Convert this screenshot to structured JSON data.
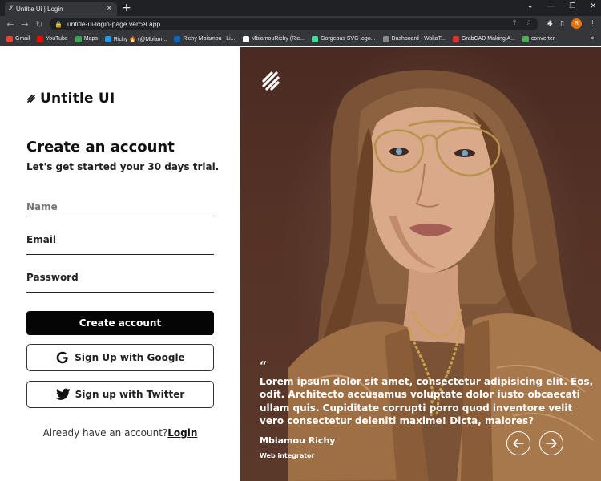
{
  "browser": {
    "tab_title": "Untitle Ui | Login",
    "url": "untitle-ui-login-page.vercel.app",
    "profile_initial": "R",
    "bookmarks": [
      {
        "label": "Gmail",
        "color": "#ea4335"
      },
      {
        "label": "YouTube",
        "color": "#ff0000"
      },
      {
        "label": "Maps",
        "color": "#34a853"
      },
      {
        "label": "Richy 🔥 (@Mbiam...",
        "color": "#1d9bf0"
      },
      {
        "label": "Richy Mbiamou | Li...",
        "color": "#0a66c2"
      },
      {
        "label": "MbiamouRichy (Ric...",
        "color": "#ffffff"
      },
      {
        "label": "Gorgeous SVG logo...",
        "color": "#3ddc97"
      },
      {
        "label": "Dashboard - WakaT...",
        "color": "#888888"
      },
      {
        "label": "GrabCAD Making A...",
        "color": "#e0312b"
      },
      {
        "label": "converter",
        "color": "#4caf50"
      }
    ]
  },
  "brand": {
    "name": "Untitle UI"
  },
  "form": {
    "heading": "Create an account",
    "subheading": "Let's get started your 30 days trial.",
    "name_placeholder": "Name",
    "email_label": "Email",
    "password_label": "Password",
    "create_button": "Create account",
    "google_button": "Sign Up with Google",
    "twitter_button": "Sign up with Twitter",
    "login_prompt": "Already have an account?",
    "login_link": "Login"
  },
  "hero": {
    "quote_mark": "“",
    "quote": "Lorem ipsum dolor sit amet, consectetur adipisicing elit. Eos, odit. Architecto accusamus voluptate dolor iusto obcaecati ullam quis. Cupiditate corrupti porro quod inventore velit vero consectetur deleniti maxime! Dicta, maiores?",
    "author": "Mbiamou Richy",
    "role": "Web integrator"
  },
  "colors": {
    "primary_button": "#050505",
    "hero_bg": "#5a3628",
    "text_dark": "#111111"
  }
}
